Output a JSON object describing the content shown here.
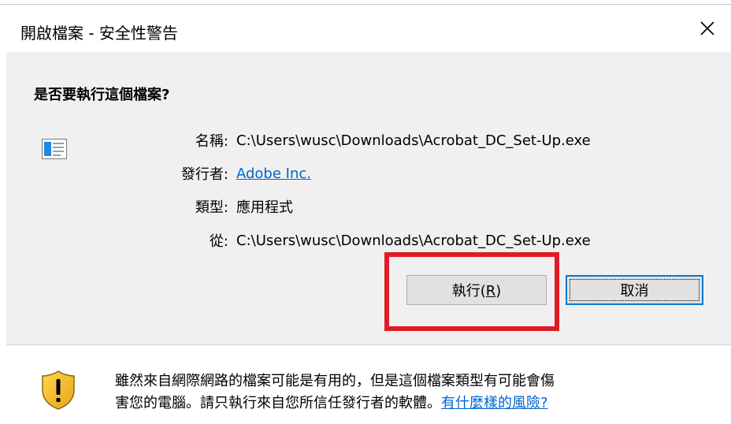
{
  "window": {
    "title": "開啟檔案 - 安全性警告"
  },
  "prompt": {
    "question": "是否要執行這個檔案?"
  },
  "details": [
    {
      "label": "名稱:",
      "value": "C:\\Users\\wusc\\Downloads\\Acrobat_DC_Set-Up.exe",
      "link": false
    },
    {
      "label": "發行者:",
      "value": "Adobe Inc.",
      "link": true
    },
    {
      "label": "類型:",
      "value": "應用程式",
      "link": false
    },
    {
      "label": "從:",
      "value": "C:\\Users\\wusc\\Downloads\\Acrobat_DC_Set-Up.exe",
      "link": false
    }
  ],
  "buttons": {
    "run_label": "執行(",
    "run_key": "R",
    "run_suffix": ")",
    "cancel_label": "取消"
  },
  "warning": {
    "text_line1": "雖然來自網際網路的檔案可能是有用的，但是這個檔案類型有可能會傷",
    "text_line2": "害您的電腦。請只執行來自您所信任發行者的軟體。",
    "link_text": "有什麼樣的風險?"
  },
  "colors": {
    "highlight": "#e01b24",
    "link": "#0066cc",
    "focus": "#0078d7",
    "panel": "#f0f0f0"
  },
  "icons": [
    "close-icon",
    "application-icon",
    "shield-warning-icon"
  ]
}
